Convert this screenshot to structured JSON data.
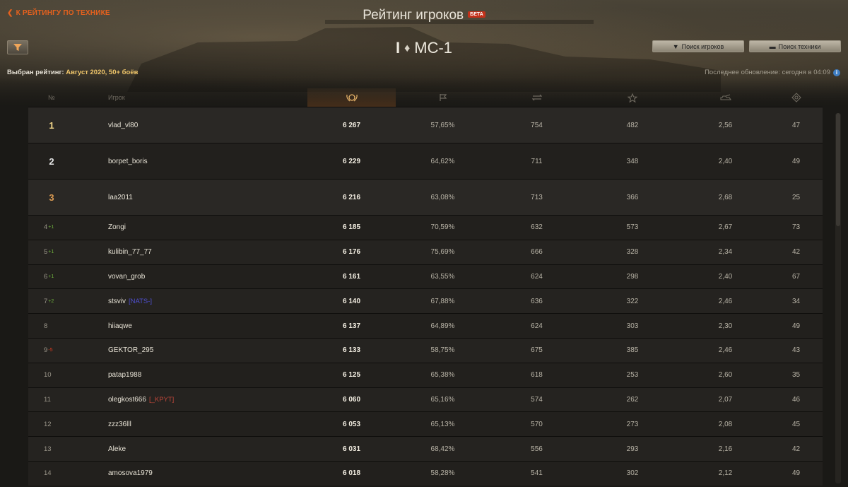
{
  "header": {
    "back_link": "К РЕЙТИНГУ ПО ТЕХНИКЕ",
    "title": "Рейтинг игроков",
    "badge": "БЕТА"
  },
  "vehicle": {
    "tier": "I",
    "name": "МС-1"
  },
  "buttons": {
    "search_players": "Поиск игроков",
    "search_vehicles": "Поиск техники"
  },
  "rating_info": {
    "label": "Выбран рейтинг:",
    "value": "Август 2020, 50+ боёв",
    "last_update": "Последнее обновление: сегодня в 04:09"
  },
  "columns": {
    "rank": "№",
    "player": "Игрок",
    "score_icon": "rating-laurel-icon",
    "winrate_icon": "flag-icon",
    "battles_icon": "crossed-arrows-icon",
    "exp_icon": "star-icon",
    "damage_icon": "tank-damage-icon",
    "kills_icon": "target-icon"
  },
  "colors": {
    "accent": "#e5611e",
    "delta_up": "#6fb23d",
    "delta_down": "#d63a1f",
    "clan_nats": "#4f4fcf",
    "clan_kpyt": "#c0473a"
  },
  "rows": [
    {
      "rank": "1",
      "delta": "",
      "delta_dir": "",
      "name": "vlad_vl80",
      "clan": "",
      "clan_color": "",
      "score": "6 267",
      "win": "57,65%",
      "battles": "754",
      "exp": "482",
      "dmg": "2,56",
      "kills": "47",
      "medal": "gold"
    },
    {
      "rank": "2",
      "delta": "",
      "delta_dir": "",
      "name": "borpet_boris",
      "clan": "",
      "clan_color": "",
      "score": "6 229",
      "win": "64,62%",
      "battles": "711",
      "exp": "348",
      "dmg": "2,40",
      "kills": "49",
      "medal": "silver"
    },
    {
      "rank": "3",
      "delta": "",
      "delta_dir": "",
      "name": "laa2011",
      "clan": "",
      "clan_color": "",
      "score": "6 216",
      "win": "63,08%",
      "battles": "713",
      "exp": "366",
      "dmg": "2,68",
      "kills": "25",
      "medal": "bronze"
    },
    {
      "rank": "4",
      "delta": "+1",
      "delta_dir": "up",
      "name": "Zongi",
      "clan": "",
      "clan_color": "",
      "score": "6 185",
      "win": "70,59%",
      "battles": "632",
      "exp": "573",
      "dmg": "2,67",
      "kills": "73",
      "medal": ""
    },
    {
      "rank": "5",
      "delta": "+1",
      "delta_dir": "up",
      "name": "kulibin_77_77",
      "clan": "",
      "clan_color": "",
      "score": "6 176",
      "win": "75,69%",
      "battles": "666",
      "exp": "328",
      "dmg": "2,34",
      "kills": "42",
      "medal": ""
    },
    {
      "rank": "6",
      "delta": "+1",
      "delta_dir": "up",
      "name": "vovan_grob",
      "clan": "",
      "clan_color": "",
      "score": "6 161",
      "win": "63,55%",
      "battles": "624",
      "exp": "298",
      "dmg": "2,40",
      "kills": "67",
      "medal": ""
    },
    {
      "rank": "7",
      "delta": "+2",
      "delta_dir": "up",
      "name": "stsviv",
      "clan": "[NATS-]",
      "clan_color": "#4f4fcf",
      "score": "6 140",
      "win": "67,88%",
      "battles": "636",
      "exp": "322",
      "dmg": "2,46",
      "kills": "34",
      "medal": ""
    },
    {
      "rank": "8",
      "delta": "",
      "delta_dir": "",
      "name": "hiiaqwe",
      "clan": "",
      "clan_color": "",
      "score": "6 137",
      "win": "64,89%",
      "battles": "624",
      "exp": "303",
      "dmg": "2,30",
      "kills": "49",
      "medal": ""
    },
    {
      "rank": "9",
      "delta": "-5",
      "delta_dir": "down",
      "name": "GEKTOR_295",
      "clan": "",
      "clan_color": "",
      "score": "6 133",
      "win": "58,75%",
      "battles": "675",
      "exp": "385",
      "dmg": "2,46",
      "kills": "43",
      "medal": ""
    },
    {
      "rank": "10",
      "delta": "",
      "delta_dir": "",
      "name": "patap1988",
      "clan": "",
      "clan_color": "",
      "score": "6 125",
      "win": "65,38%",
      "battles": "618",
      "exp": "253",
      "dmg": "2,60",
      "kills": "35",
      "medal": ""
    },
    {
      "rank": "11",
      "delta": "",
      "delta_dir": "",
      "name": "olegkost666",
      "clan": "[_KPYT]",
      "clan_color": "#c0473a",
      "score": "6 060",
      "win": "65,16%",
      "battles": "574",
      "exp": "262",
      "dmg": "2,07",
      "kills": "46",
      "medal": ""
    },
    {
      "rank": "12",
      "delta": "",
      "delta_dir": "",
      "name": "zzz36lll",
      "clan": "",
      "clan_color": "",
      "score": "6 053",
      "win": "65,13%",
      "battles": "570",
      "exp": "273",
      "dmg": "2,08",
      "kills": "45",
      "medal": ""
    },
    {
      "rank": "13",
      "delta": "",
      "delta_dir": "",
      "name": "Aleke",
      "clan": "",
      "clan_color": "",
      "score": "6 031",
      "win": "68,42%",
      "battles": "556",
      "exp": "293",
      "dmg": "2,16",
      "kills": "42",
      "medal": ""
    },
    {
      "rank": "14",
      "delta": "",
      "delta_dir": "",
      "name": "amosova1979",
      "clan": "",
      "clan_color": "",
      "score": "6 018",
      "win": "58,28%",
      "battles": "541",
      "exp": "302",
      "dmg": "2,12",
      "kills": "49",
      "medal": ""
    }
  ]
}
